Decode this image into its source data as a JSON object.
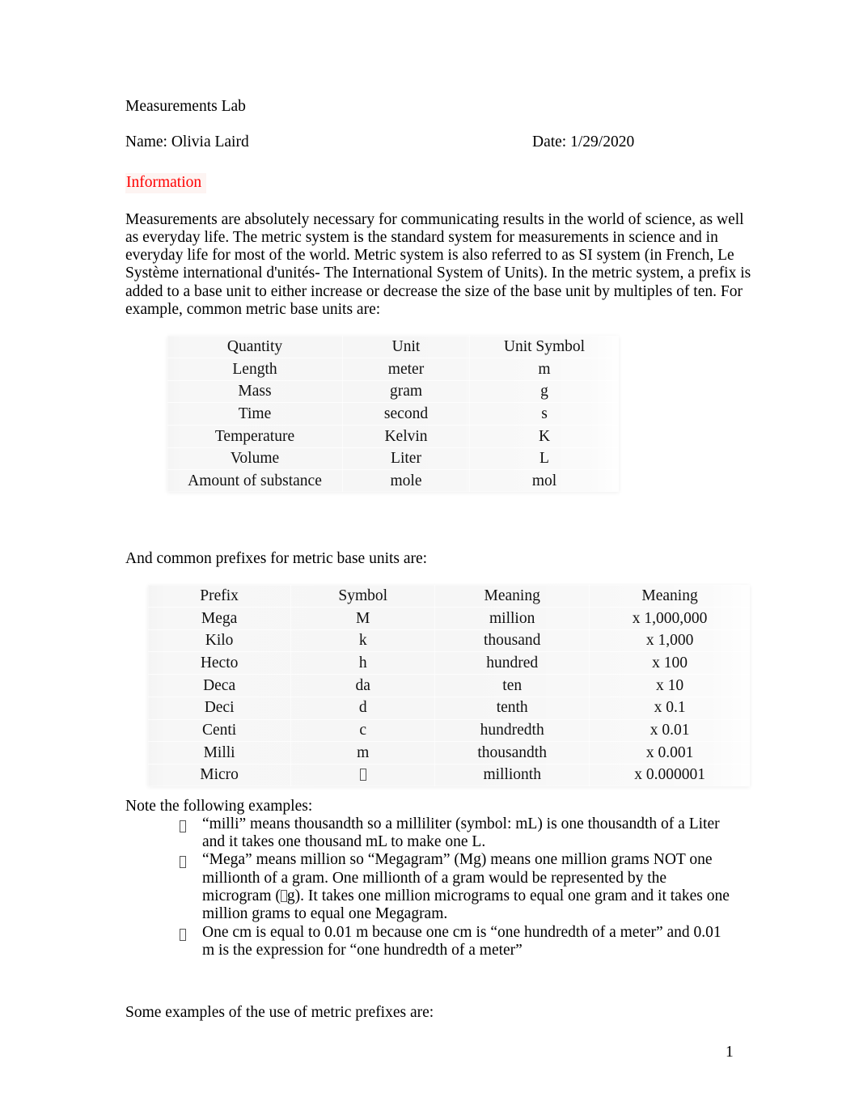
{
  "document": {
    "title": "Measurements Lab",
    "name_label": "Name: Olivia Laird",
    "date_label": "Date: 1/29/2020",
    "section_heading": "Information",
    "page_number": "1"
  },
  "intro": {
    "paragraph": "Measurements are absolutely necessary for communicating results in the world of science, as well as everyday life. The metric system is the standard system for measurements in science and in everyday life for most of the world. Metric system is also referred to as SI system (in French, Le Système international d'unités-  The International System of Units). In the metric system, a prefix is added to a base unit to either increase or decrease the size of the base unit by multiples of ten. For example, common metric base units are:"
  },
  "base_units_table": {
    "headers": [
      "Quantity",
      "Unit",
      "Unit Symbol"
    ],
    "rows": [
      [
        "Length",
        "meter",
        "m"
      ],
      [
        "Mass",
        "gram",
        "g"
      ],
      [
        "Time",
        "second",
        "s"
      ],
      [
        "Temperature",
        "Kelvin",
        "K"
      ],
      [
        "Volume",
        "Liter",
        "L"
      ],
      [
        "Amount of substance",
        "mole",
        "mol"
      ]
    ]
  },
  "prefixes_lead": "And common prefixes for metric base units are:",
  "prefixes_table": {
    "headers": [
      "Prefix",
      "Symbol",
      "Meaning",
      "Meaning"
    ],
    "rows": [
      [
        "Mega",
        "M",
        "million",
        "x 1,000,000"
      ],
      [
        "Kilo",
        "k",
        "thousand",
        "x 1,000"
      ],
      [
        "Hecto",
        "h",
        "hundred",
        "x 100"
      ],
      [
        "Deca",
        "da",
        "ten",
        "x 10"
      ],
      [
        "Deci",
        "d",
        "tenth",
        "x 0.1"
      ],
      [
        "Centi",
        "c",
        "hundredth",
        "x 0.01"
      ],
      [
        "Milli",
        "m",
        "thousandth",
        "x 0.001"
      ],
      [
        "Micro",
        "",
        "millionth",
        "x 0.000001"
      ]
    ],
    "micro_symbol_note": "missing-glyph-box"
  },
  "notes": {
    "lead": "Note the following examples:",
    "bullet_marker": "missing-glyph-box",
    "items": [
      {
        "text_before": "“milli” means thousandth so a milliliter (symbol: mL) is one thousandth of a Liter and it takes one thousand mL to make one L."
      },
      {
        "part1": "“Mega” means million so “Megagram” (Mg) means one million grams NOT one millionth of a gram.  One millionth of a gram would be represented by the microgram (",
        "part2": "g).  It takes one million micrograms to equal one gram and it takes one million grams to equal one Megagram."
      },
      {
        "text_before": "One cm is equal to 0.01 m because one cm is “one hundredth of a meter” and 0.01 m is the expression for “one hundredth of a meter”"
      }
    ]
  },
  "closing": {
    "text": "Some examples of the use of metric prefixes are:"
  }
}
